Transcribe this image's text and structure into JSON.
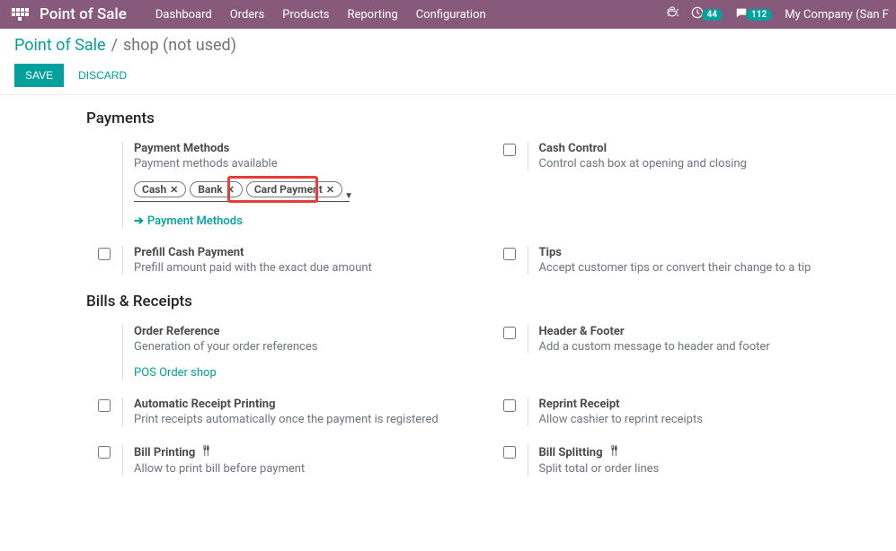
{
  "nav": {
    "brand": "Point of Sale",
    "items": [
      "Dashboard",
      "Orders",
      "Products",
      "Reporting",
      "Configuration"
    ],
    "badge1": "44",
    "badge2": "112",
    "company": "My Company (San F"
  },
  "breadcrumb": {
    "root": "Point of Sale",
    "sep": "/",
    "current": "shop (not used)"
  },
  "actions": {
    "save": "SAVE",
    "discard": "DISCARD"
  },
  "sections": {
    "payments": {
      "title": "Payments",
      "payment_methods": {
        "label": "Payment Methods",
        "desc": "Payment methods available",
        "tags": [
          "Cash",
          "Bank",
          "Card Payment"
        ],
        "link": "Payment Methods"
      },
      "cash_control": {
        "label": "Cash Control",
        "desc": "Control cash box at opening and closing"
      },
      "prefill": {
        "label": "Prefill Cash Payment",
        "desc": "Prefill amount paid with the exact due amount"
      },
      "tips": {
        "label": "Tips",
        "desc": "Accept customer tips or convert their change to a tip"
      }
    },
    "bills": {
      "title": "Bills & Receipts",
      "order_ref": {
        "label": "Order Reference",
        "desc": "Generation of your order references",
        "link": "POS Order shop"
      },
      "header_footer": {
        "label": "Header & Footer",
        "desc": "Add a custom message to header and footer"
      },
      "auto_print": {
        "label": "Automatic Receipt Printing",
        "desc": "Print receipts automatically once the payment is registered"
      },
      "reprint": {
        "label": "Reprint Receipt",
        "desc": "Allow cashier to reprint receipts"
      },
      "bill_printing": {
        "label": "Bill Printing",
        "desc": "Allow to print bill before payment"
      },
      "bill_splitting": {
        "label": "Bill Splitting",
        "desc": "Split total or order lines"
      }
    }
  }
}
